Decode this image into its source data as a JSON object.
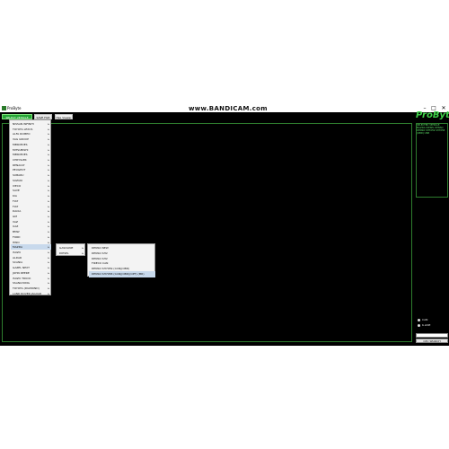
{
  "window": {
    "title": "ProByte",
    "watermark": "www.BANDICAM.com",
    "min": "–",
    "max": "□",
    "close": "✕"
  },
  "toolbar": {
    "button_1": "SELECT VEHICLE",
    "button_2": "SAVE FILE",
    "button_3": "Hex Viewer"
  },
  "side_panel": {
    "logo": "ProByte",
    "info_text": "SELECTED VEHICLE: MAZDA DIESEL DENSO DENSO SH7059 SH7058 (OBD) USB",
    "radio_1": "CAN",
    "radio_2": "K-LINE",
    "search_value": "",
    "search_button": "CPU SEARCH"
  },
  "menus": {
    "brands": [
      "NISSAN INFINITI",
      "TOYOTA LEXUS",
      "ALFA ROMEO",
      "VAG GROUP",
      "MERCEDES",
      "MITSUBISHI",
      "MERCEDES",
      "CHRYSLER",
      "RENAULT",
      "PEUGEOT",
      "SUBARU",
      "SUZUKI",
      "IVECO",
      "SAVE",
      "KIA",
      "FIAT",
      "FIAT",
      "DACIA",
      "GM",
      "VAZ",
      "UAZ",
      "BMW",
      "FORD",
      "HINO",
      "MAZDA",
      "ISUZU",
      "ALDAR",
      "SCANIA",
      "GAZEL NEXT",
      "JOHN DEERE",
      "ISUZU TRUCK",
      "SSANGYONG",
      "TOYOTA (DIAMOND)",
      "LAND ROVER JAGUAR"
    ],
    "highlighted_brand_index": 24,
    "fuel": [
      "GASOLINE",
      "DIESEL"
    ],
    "ecu": [
      "DENSO NEW",
      "DENSO SH2",
      "DENSO SH2",
      "FIRECO CAN",
      "DENSO SH7059 (CAN)(OBD)",
      "DENSO SH7058 (CAN)(OBD)(OPT) (MR)"
    ],
    "highlighted_ecu_index": 5
  }
}
